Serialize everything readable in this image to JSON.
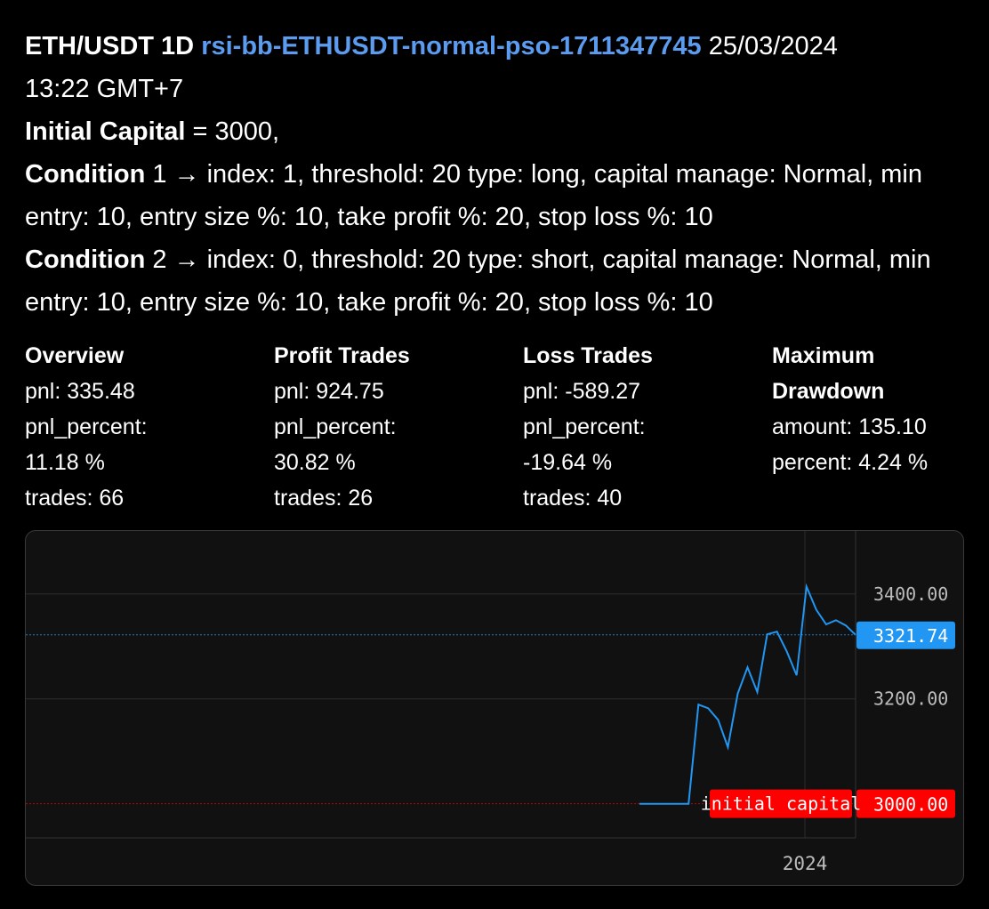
{
  "header": {
    "pair": "ETH/USDT 1D",
    "strategy_id": "rsi-bb-ETHUSDT-normal-pso-1711347745",
    "date": "25/03/2024",
    "time": "13:22 GMT+7",
    "initial_capital_label": "Initial Capital",
    "initial_capital_value": " = 3000,",
    "condition1_label": "Condition",
    "condition1_text": " 1 → index: 1, threshold: 20 type: long, capital manage: Normal, min entry: 10, entry size %: 10, take profit %: 20, stop loss %: 10",
    "condition2_label": "Condition",
    "condition2_text": " 2 → index: 0, threshold: 20 type: short, capital manage: Normal, min entry: 10, entry size %: 10, take profit %: 20, stop loss %: 10"
  },
  "stats": {
    "overview": {
      "heading": "Overview",
      "pnl": "pnl: 335.48",
      "pnl_percent_label": "pnl_percent:",
      "pnl_percent": "11.18 %",
      "trades": "trades: 66"
    },
    "profit": {
      "heading": "Profit Trades",
      "pnl": "pnl: 924.75",
      "pnl_percent_label": "pnl_percent:",
      "pnl_percent": "30.82 %",
      "trades": "trades: 26"
    },
    "loss": {
      "heading": "Loss Trades",
      "pnl": "pnl: -589.27",
      "pnl_percent_label": "pnl_percent:",
      "pnl_percent": "-19.64 %",
      "trades": "trades: 40"
    },
    "drawdown": {
      "heading_line1": "Maximum",
      "heading_line2": "Drawdown",
      "amount": "amount: 135.10",
      "percent": "percent: 4.24 %"
    }
  },
  "chart_data": {
    "type": "line",
    "title": "",
    "xlabel": "",
    "ylabel": "",
    "x_ticks": [
      "2024"
    ],
    "y_ticks": [
      3200,
      3400
    ],
    "y_tick_labels": [
      "3200.00",
      "3400.00"
    ],
    "ylim": [
      2935,
      3520
    ],
    "series": [
      {
        "color": "#2196f3",
        "values": [
          3000,
          3000,
          3000,
          3000,
          3000,
          3000,
          3189,
          3182,
          3160,
          3108,
          3210,
          3260,
          3213,
          3323,
          3328,
          3290,
          3245,
          3414,
          3370,
          3342,
          3350,
          3340,
          3322
        ]
      }
    ],
    "last_value_label": "3321.74",
    "last_value_color": "#2196f3",
    "initial_capital_label": "initial capital",
    "initial_capital_value": 3000,
    "initial_capital_value_label": "3000.00",
    "initial_capital_color": "#ff0000",
    "grid": true,
    "legend": "none"
  }
}
